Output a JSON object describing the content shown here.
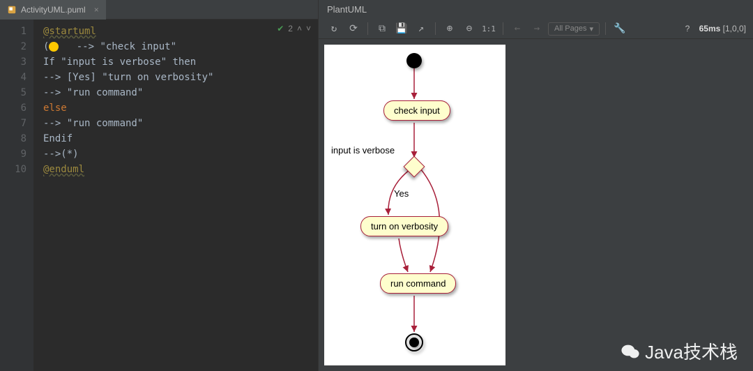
{
  "tab": {
    "filename": "ActivityUML.puml"
  },
  "editor": {
    "inspection_count": "2",
    "lines": [
      {
        "n": 1,
        "segs": [
          {
            "cls": "t-tag",
            "t": "@startuml"
          }
        ]
      },
      {
        "n": 2,
        "segs": [
          {
            "t": "("
          },
          {
            "cls": "emoji",
            "t": ""
          },
          {
            "t": "   --> "
          },
          {
            "cls": "t-str",
            "t": "\"check input\""
          }
        ]
      },
      {
        "n": 3,
        "segs": [
          {
            "t": "If "
          },
          {
            "cls": "t-str",
            "t": "\"input is verbose\""
          },
          {
            "t": " then"
          }
        ]
      },
      {
        "n": 4,
        "segs": [
          {
            "t": "--> [Yes] "
          },
          {
            "cls": "t-str",
            "t": "\"turn on verbosity\""
          }
        ]
      },
      {
        "n": 5,
        "segs": [
          {
            "t": "--> "
          },
          {
            "cls": "t-str",
            "t": "\"run command\""
          }
        ]
      },
      {
        "n": 6,
        "segs": [
          {
            "cls": "t-kw",
            "t": "else"
          }
        ]
      },
      {
        "n": 7,
        "segs": [
          {
            "t": "--> "
          },
          {
            "cls": "t-str",
            "t": "\"run command\""
          }
        ]
      },
      {
        "n": 8,
        "segs": [
          {
            "t": "Endif"
          }
        ]
      },
      {
        "n": 9,
        "segs": [
          {
            "t": "-->(*) "
          }
        ]
      },
      {
        "n": 10,
        "segs": [
          {
            "cls": "t-tag",
            "t": "@enduml"
          }
        ]
      }
    ]
  },
  "preview": {
    "title": "PlantUML",
    "pages_label": "All Pages",
    "zoom_label": "1:1",
    "stats_time": "65ms",
    "stats_pages": "[1,0,0]",
    "nodes": {
      "check_input": "check input",
      "turn_on_verbosity": "turn on verbosity",
      "run_command": "run command"
    },
    "labels": {
      "condition": "input is verbose",
      "yes": "Yes"
    }
  },
  "watermark": "Java技术栈"
}
